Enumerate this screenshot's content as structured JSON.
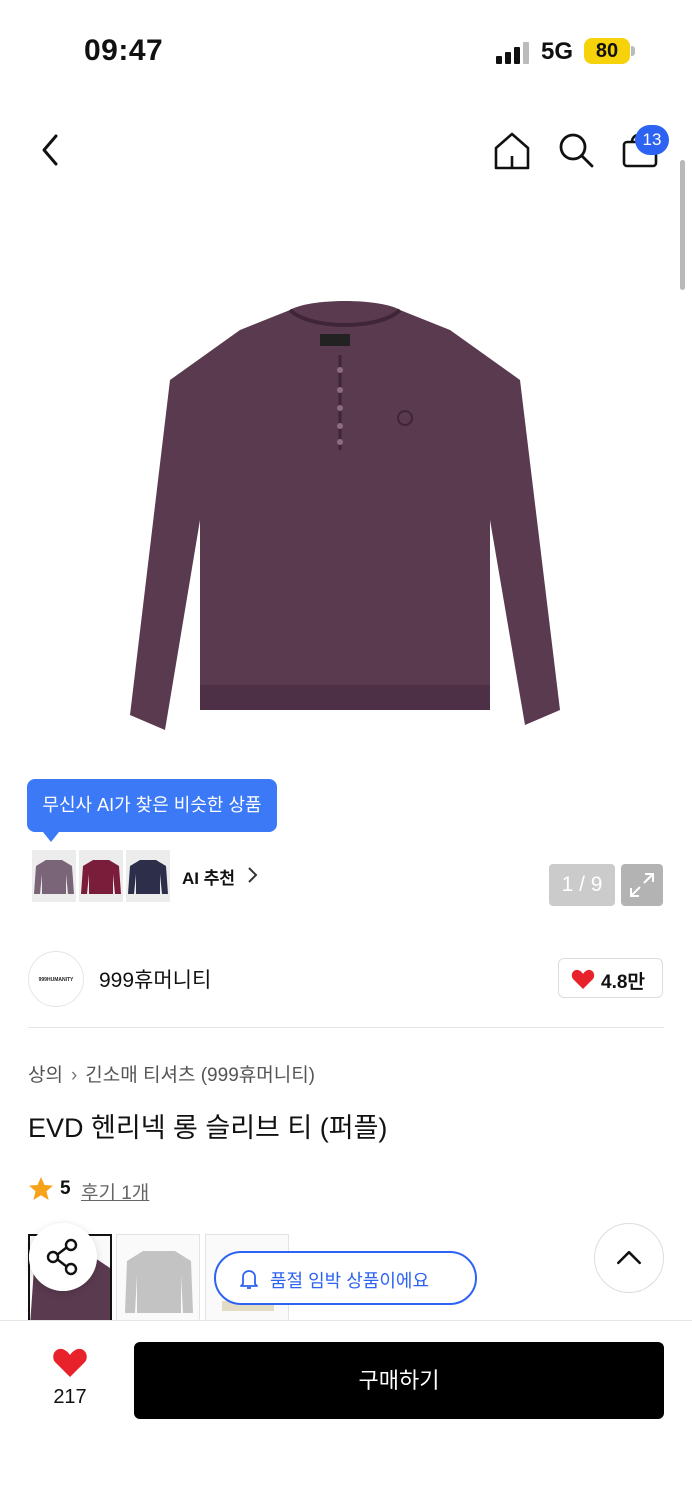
{
  "status_bar": {
    "time": "09:47",
    "network": "5G",
    "battery": "80"
  },
  "header": {
    "cart_count": "13"
  },
  "gallery": {
    "pager": "1 / 9"
  },
  "ai_recommend": {
    "tooltip": "무신사 AI가 찾은 비슷한 상품",
    "label": "AI 추천"
  },
  "brand": {
    "logo_text": "999HUMANITY",
    "name": "999휴머니티",
    "likes": "4.8만"
  },
  "breadcrumb": {
    "category": "상의",
    "subcategory": "긴소매 티셔츠 (999휴머니티)"
  },
  "product": {
    "title": "EVD 헨리넥 롱 슬리브 티 (퍼플)",
    "rating": "5",
    "reviews": "후기 1개"
  },
  "notice": {
    "soldout_text": "품절 임박 상품이에요"
  },
  "bottom": {
    "wish_count": "217",
    "buy_label": "구매하기"
  },
  "colors": {
    "accent_blue": "#2d63f2",
    "tooltip_blue": "#3b79f6",
    "heart_red": "#e8222a",
    "star_orange": "#f7a21b",
    "battery_yellow": "#f5d20a"
  }
}
